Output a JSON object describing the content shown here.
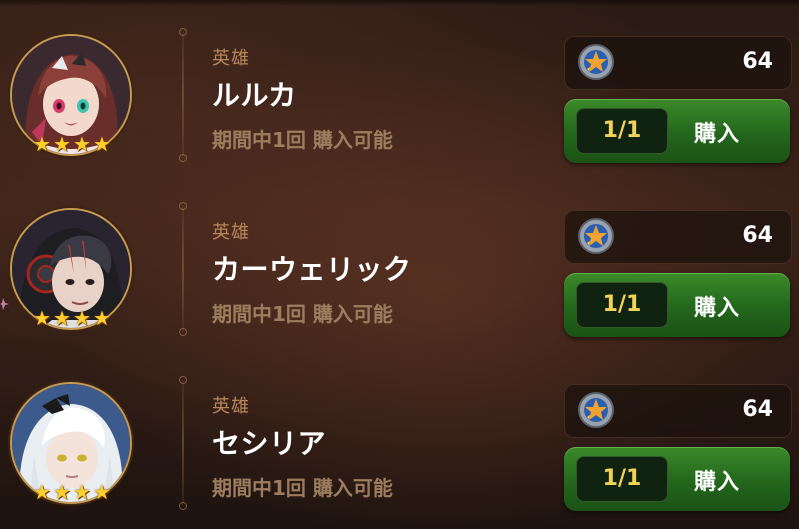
{
  "shop_items": [
    {
      "type_label": "英雄",
      "name": "ルルカ",
      "limit_text": "期間中1回 購入可能",
      "price": "64",
      "count": "1/1",
      "buy_label": "購入",
      "stars": 4,
      "avatar_colors": {
        "hair": "#6a2e2a",
        "hair_light": "#8a4038",
        "skin": "#f3d8cc",
        "bg": "#3a2a30",
        "eye": "#3fc6b0",
        "accent": "#d63b6a"
      }
    },
    {
      "type_label": "英雄",
      "name": "カーウェリック",
      "limit_text": "期間中1回 購入可能",
      "price": "64",
      "count": "1/1",
      "buy_label": "購入",
      "stars": 4,
      "avatar_colors": {
        "hair": "#1d1d22",
        "hair_light": "#3a3a44",
        "skin": "#e8d2c8",
        "bg": "#2a2430",
        "eye": "#b33a3a",
        "accent": "#a3261f"
      }
    },
    {
      "type_label": "英雄",
      "name": "セシリア",
      "limit_text": "期間中1回 購入可能",
      "price": "64",
      "count": "1/1",
      "buy_label": "購入",
      "stars": 4,
      "avatar_colors": {
        "hair": "#e9eef2",
        "hair_light": "#ffffff",
        "skin": "#f4e3da",
        "bg": "#3c5a8c",
        "eye": "#c9b232",
        "accent": "#1a1a1a"
      }
    }
  ],
  "icons": {
    "currency": "star-coin-icon",
    "rating": "star-icon"
  },
  "colors": {
    "button_green": "#2f7a24",
    "count_text": "#f2d35a",
    "type_label": "#b7895a",
    "limit_text": "#9c7e5f",
    "star": "#ffcf2e"
  }
}
